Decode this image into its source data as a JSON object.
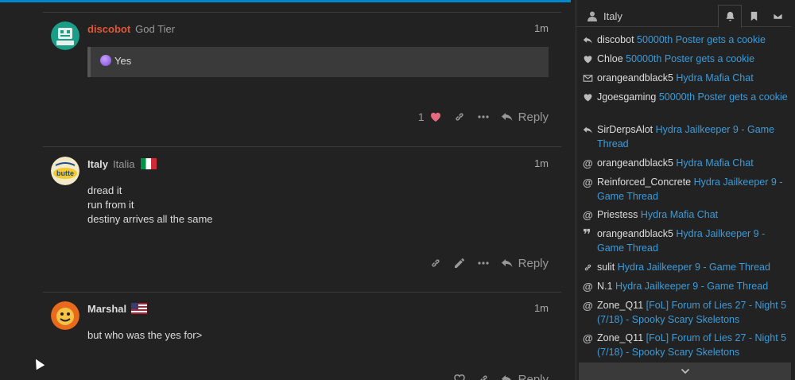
{
  "posts": [
    {
      "username": "discobot",
      "title": "God Tier",
      "time": "1m",
      "quote_text": "Yes",
      "like_count": "1",
      "reply_label": "Reply"
    },
    {
      "username": "Italy",
      "title": "Italia",
      "time": "1m",
      "lines": [
        "dread it",
        "run from it",
        "destiny arrives all the same"
      ],
      "reply_label": "Reply"
    },
    {
      "username": "Marshal",
      "title": "",
      "time": "1m",
      "lines": [
        "but who was the yes for>"
      ],
      "reply_label": "Reply"
    }
  ],
  "panel": {
    "user_name": "Italy",
    "notifications": [
      {
        "icon": "reply-icon",
        "who": "discobot",
        "what": "50000th Poster gets a cookie"
      },
      {
        "icon": "heart-icon",
        "who": "Chloe",
        "what": "50000th Poster gets a cookie"
      },
      {
        "icon": "envelope-icon",
        "who": "orangeandblack5",
        "what": "Hydra Mafia Chat"
      },
      {
        "icon": "heart-icon",
        "who": "Jgoesgaming",
        "what": "50000th Poster gets a cookie"
      },
      {
        "icon": "reply-icon",
        "who": "SirDerpsAlot",
        "what": "Hydra Jailkeeper 9 - Game Thread"
      },
      {
        "icon": "at-icon",
        "who": "orangeandblack5",
        "what": "Hydra Mafia Chat"
      },
      {
        "icon": "at-icon",
        "who": "Reinforced_Concrete",
        "what": "Hydra Jailkeeper 9 - Game Thread"
      },
      {
        "icon": "at-icon",
        "who": "Priestess",
        "what": "Hydra Mafia Chat"
      },
      {
        "icon": "quote-icon",
        "who": "orangeandblack5",
        "what": "Hydra Jailkeeper 9 - Game Thread"
      },
      {
        "icon": "link-icon",
        "who": "sulit",
        "what": "Hydra Jailkeeper 9 - Game Thread"
      },
      {
        "icon": "at-icon",
        "who": "N.1",
        "what": "Hydra Jailkeeper 9 - Game Thread"
      },
      {
        "icon": "at-icon",
        "who": "Zone_Q11",
        "what": "[FoL] Forum of Lies 27 - Night 5 (7/18) - Spooky Scary Skeletons"
      },
      {
        "icon": "at-icon",
        "who": "Zone_Q11",
        "what": "[FoL] Forum of Lies 27 - Night 5 (7/18) - Spooky Scary Skeletons"
      }
    ]
  },
  "colors": {
    "accent": "#0088cc",
    "link": "#3d9bd9",
    "staff_name": "#e45735",
    "background": "#222222"
  }
}
